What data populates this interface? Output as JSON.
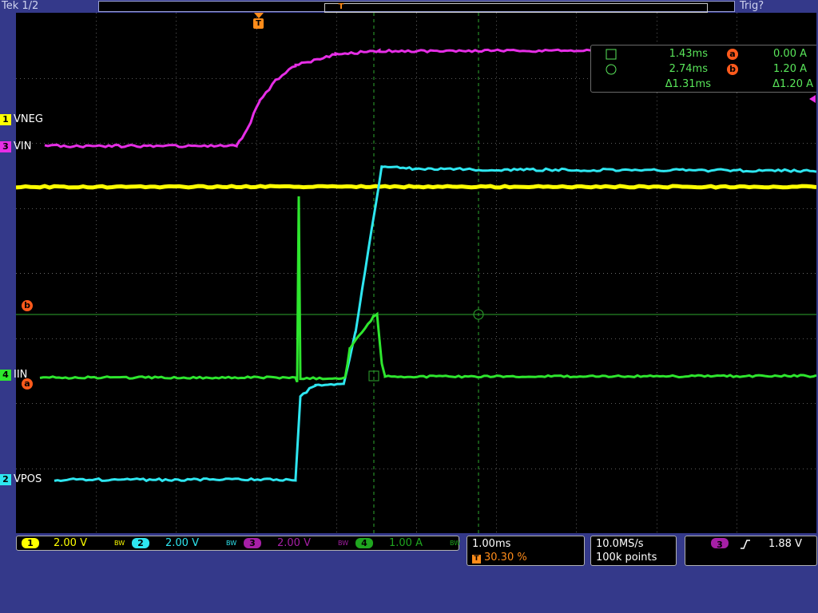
{
  "topbar": {
    "brand": "Tek",
    "page": "1/2",
    "trigger_status": "Trig?"
  },
  "markers": {
    "trigger_marker": "T",
    "cursor_a": "a",
    "cursor_b": "b"
  },
  "channels": [
    {
      "num": "1",
      "name": "VNEG",
      "color": "#ffff00",
      "scale": "2.00 V"
    },
    {
      "num": "2",
      "name": "VPOS",
      "color": "#2ee6f0",
      "scale": "2.00 V"
    },
    {
      "num": "3",
      "name": "VIN",
      "color": "#e62ee6",
      "scale": "2.00 V"
    },
    {
      "num": "4",
      "name": "IIN",
      "color": "#2ee62e",
      "scale": "1.00 A"
    }
  ],
  "bw_label": "BW",
  "cursor_readout": {
    "t1": "1.43ms",
    "i1": "0.00 A",
    "t2": "2.74ms",
    "i2": "1.20 A",
    "dt": "Δ1.31ms",
    "di": "Δ1.20 A"
  },
  "timebase": {
    "scale": "1.00ms",
    "trigger_position": "30.30 %"
  },
  "acquisition": {
    "sample_rate": "10.0MS/s",
    "record_length": "100k points"
  },
  "trigger": {
    "source": "3",
    "slope": "rising",
    "level": "1.88 V"
  },
  "colors": {
    "background": "#34398a",
    "cursor_badge": "#ff5a1c",
    "readout_text": "#59e65a"
  }
}
